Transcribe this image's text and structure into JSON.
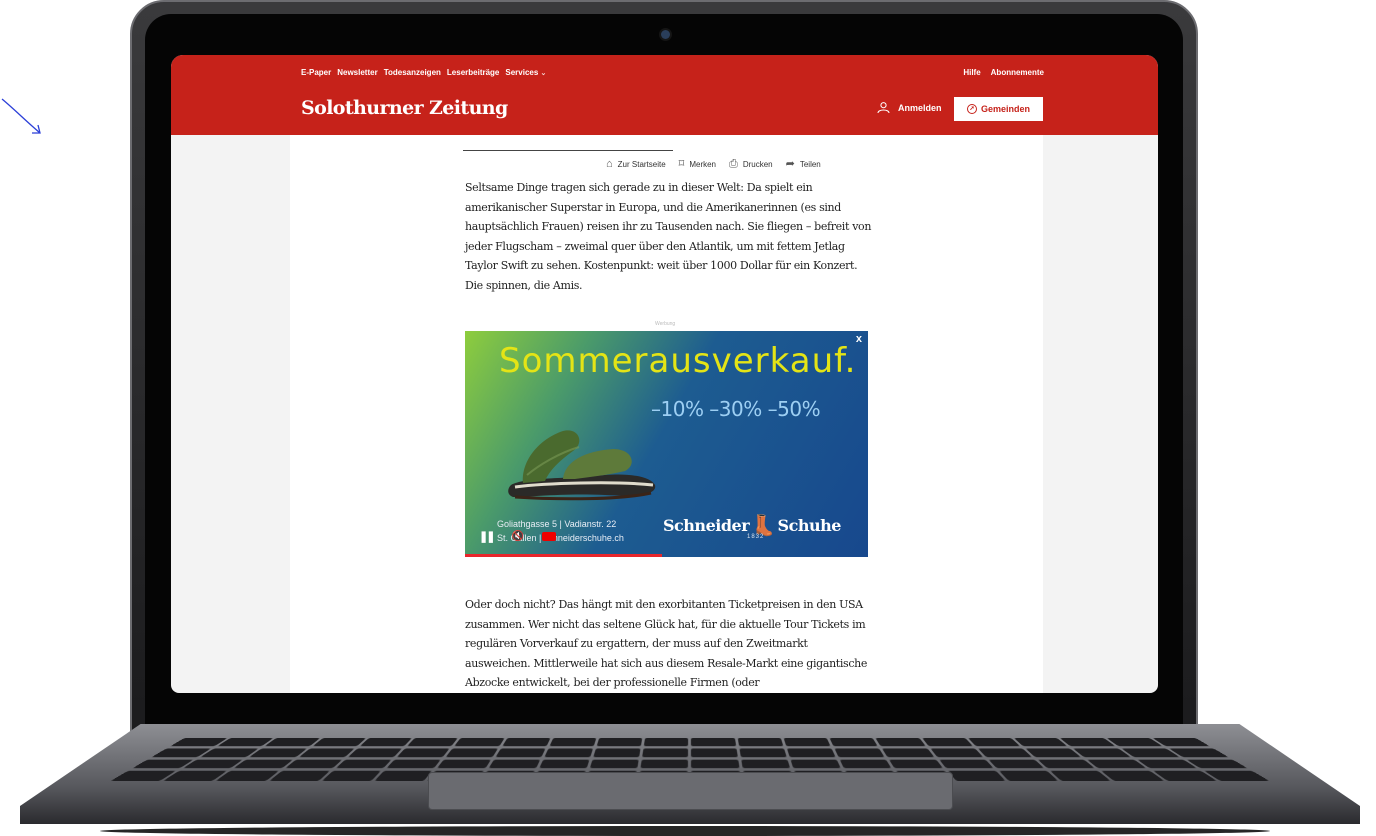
{
  "colors": {
    "brand_red": "#c6221a",
    "background_yellow": "#fbf21a",
    "ad_title_yellow": "#e4e416"
  },
  "header": {
    "top_nav": [
      "E-Paper",
      "Newsletter",
      "Todesanzeigen",
      "Leserbeiträge",
      "Services"
    ],
    "top_nav_right": [
      "Hilfe",
      "Abonnemente"
    ],
    "logo": "Solothurner Zeitung",
    "login_label": "Anmelden",
    "gemeinden_label": "Gemeinden"
  },
  "toolbar": {
    "home": "Zur Startseite",
    "bookmark": "Merken",
    "print": "Drucken",
    "share": "Teilen"
  },
  "article": {
    "paragraph_1": "Seltsame Dinge tragen sich gerade zu in dieser Welt: Da spielt ein amerikanischer Superstar in Europa, und die Amerikanerinnen (es sind hauptsächlich Frauen) reisen ihr zu Tausenden nach. Sie fliegen – befreit von jeder Flugscham – zweimal quer über den Atlantik, um mit fettem Jetlag Taylor Swift zu sehen. Kostenpunkt: weit über 1000 Dollar für ein Konzert. Die spinnen, die Amis.",
    "paragraph_2": "Oder doch nicht? Das hängt mit den exorbitanten Ticketpreisen in den USA zusammen. Wer nicht das seltene Glück hat, für die aktuelle Tour Tickets im regulären Vorverkauf zu ergattern, der muss auf den Zweitmarkt ausweichen. Mittlerweile hat sich aus diesem Resale-Markt eine gigantische Abzocke entwickelt, bei der professionelle Firmen (oder"
  },
  "ad": {
    "label": "Werbung",
    "close": "x",
    "title": "Sommerausverkauf.",
    "discounts": "–10% –30% –50%",
    "address_line_1": "Goliathgasse 5 | Vadianstr. 22",
    "address_line_2": "St. Gallen | schneiderschuhe.ch",
    "brand_left": "Schneider",
    "brand_right": "Schuhe",
    "brand_year": "1832",
    "progress_fraction": 0.49
  },
  "icons": {
    "home": "⌂",
    "bookmark": "⌑",
    "print": "⎙",
    "share": "➦",
    "login": "person",
    "gemeinden": "compass",
    "services_chevron": "⌄",
    "pause": "❚❚",
    "mute": "🔇",
    "boot": "👢"
  }
}
